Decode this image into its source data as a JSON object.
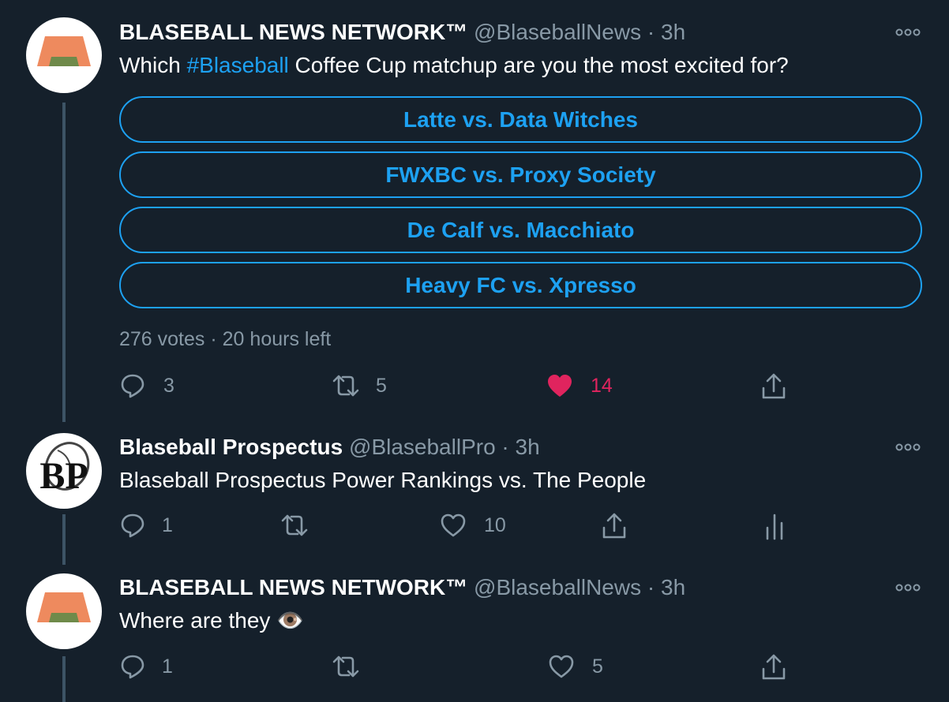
{
  "tweets": [
    {
      "name": "BLASEBALL NEWS NETWORK™",
      "handle": "@BlaseballNews",
      "time": "3h",
      "text_prefix": "Which ",
      "hashtag": "#Blaseball",
      "text_suffix": " Coffee Cup matchup are you the most excited for?",
      "avatar_icon": "bnn-logo",
      "poll": {
        "options": [
          "Latte vs. Data Witches",
          "FWXBC vs. Proxy Society",
          "De Calf vs. Macchiato",
          "Heavy FC vs. Xpresso"
        ],
        "votes": "276 votes",
        "time_left": "20 hours left"
      },
      "actions": {
        "reply": "3",
        "retweet": "5",
        "like": "14",
        "liked": true
      }
    },
    {
      "name": "Blaseball Prospectus",
      "handle": "@BlaseballPro",
      "time": "3h",
      "text": "Blaseball Prospectus Power Rankings vs. The People",
      "avatar_icon": "bp-logo",
      "actions": {
        "reply": "1",
        "retweet": "",
        "like": "10"
      }
    },
    {
      "name": "BLASEBALL NEWS NETWORK™",
      "handle": "@BlaseballNews",
      "time": "3h",
      "text": "Where are they 👁️",
      "avatar_icon": "bnn-logo",
      "actions": {
        "reply": "1",
        "retweet": "",
        "like": "5"
      }
    }
  ],
  "separator": "·",
  "colors": {
    "background": "#15202b",
    "accent": "#1da1f2",
    "secondary": "#8899a6",
    "like": "#e0245e",
    "thread_line": "#3d5466"
  }
}
